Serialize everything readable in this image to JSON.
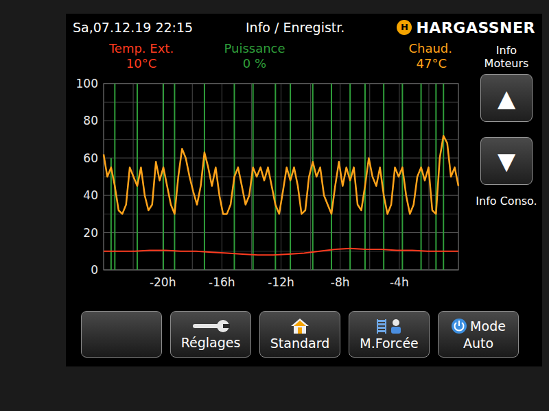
{
  "header": {
    "datetime": "Sa,07.12.19 22:15",
    "title": "Info / Enregistr.",
    "logo": "H",
    "brand": "HARGASSNER"
  },
  "chart": {
    "y_ticks": [
      "100",
      "80",
      "60",
      "40",
      "20",
      "0"
    ],
    "x_ticks": [
      {
        "label": "-20h",
        "hour": -20
      },
      {
        "label": "-16h",
        "hour": -16
      },
      {
        "label": "-12h",
        "hour": -12
      },
      {
        "label": "-8h",
        "hour": -8
      },
      {
        "label": "-4h",
        "hour": -4
      }
    ],
    "series": [
      {
        "label": "Temp. Ext.",
        "value": "10°C",
        "color": "#ff3b1f",
        "kind": "line",
        "values": [
          10,
          10,
          10,
          10.5,
          10.5,
          10,
          10,
          9.5,
          9,
          8.5,
          8,
          8,
          8.5,
          9,
          10,
          11,
          11.5,
          11,
          11,
          10.5,
          10.5,
          10,
          10,
          10
        ]
      },
      {
        "label": "Puissance",
        "value": "0 %",
        "color": "#2f9e3a",
        "kind": "spikes",
        "values": [
          0,
          0,
          60,
          100,
          0,
          0,
          0,
          0,
          0,
          100,
          0,
          0,
          0,
          0,
          0,
          0,
          100,
          0,
          0,
          100,
          0,
          0,
          0,
          0,
          0,
          0,
          0,
          100,
          0,
          0,
          0,
          0,
          0,
          0,
          0,
          100,
          0,
          0,
          0,
          0,
          100,
          0,
          0,
          0,
          0,
          0,
          100,
          0,
          0,
          0,
          100,
          0,
          0,
          0,
          0,
          0,
          100,
          0,
          0,
          0,
          0,
          100,
          0,
          0,
          0,
          0,
          100,
          0,
          0,
          0,
          100,
          0,
          0,
          0,
          0,
          100,
          0,
          0,
          0,
          0,
          100,
          0,
          0,
          0,
          0,
          100,
          0,
          0,
          0,
          100,
          0,
          100,
          0,
          0,
          0,
          0
        ]
      },
      {
        "label": "Chaud.",
        "value": "47°C",
        "color": "#ffa31a",
        "kind": "line",
        "values": [
          62,
          50,
          55,
          45,
          32,
          30,
          35,
          55,
          50,
          45,
          55,
          40,
          32,
          35,
          58,
          48,
          55,
          45,
          35,
          30,
          50,
          65,
          60,
          50,
          42,
          35,
          45,
          63,
          55,
          45,
          55,
          40,
          30,
          30,
          35,
          50,
          55,
          45,
          35,
          40,
          55,
          50,
          55,
          48,
          55,
          45,
          35,
          30,
          42,
          55,
          48,
          55,
          45,
          30,
          32,
          50,
          58,
          50,
          55,
          40,
          35,
          30,
          45,
          58,
          45,
          55,
          48,
          55,
          35,
          32,
          45,
          60,
          50,
          45,
          55,
          40,
          30,
          35,
          55,
          50,
          55,
          40,
          30,
          35,
          50,
          55,
          48,
          55,
          32,
          30,
          60,
          72,
          68,
          50,
          55,
          45
        ]
      }
    ]
  },
  "side": {
    "top_label": "Info Moteurs",
    "up": "▲",
    "down": "▼",
    "bottom_label": "Info Conso."
  },
  "buttons": [
    {
      "kind": "blank"
    },
    {
      "kind": "wrench",
      "label": "Réglages"
    },
    {
      "kind": "house",
      "label": "Standard"
    },
    {
      "kind": "forced",
      "label": "M.Forcée"
    },
    {
      "kind": "power",
      "label": "Mode",
      "sublabel": "Auto"
    }
  ]
}
